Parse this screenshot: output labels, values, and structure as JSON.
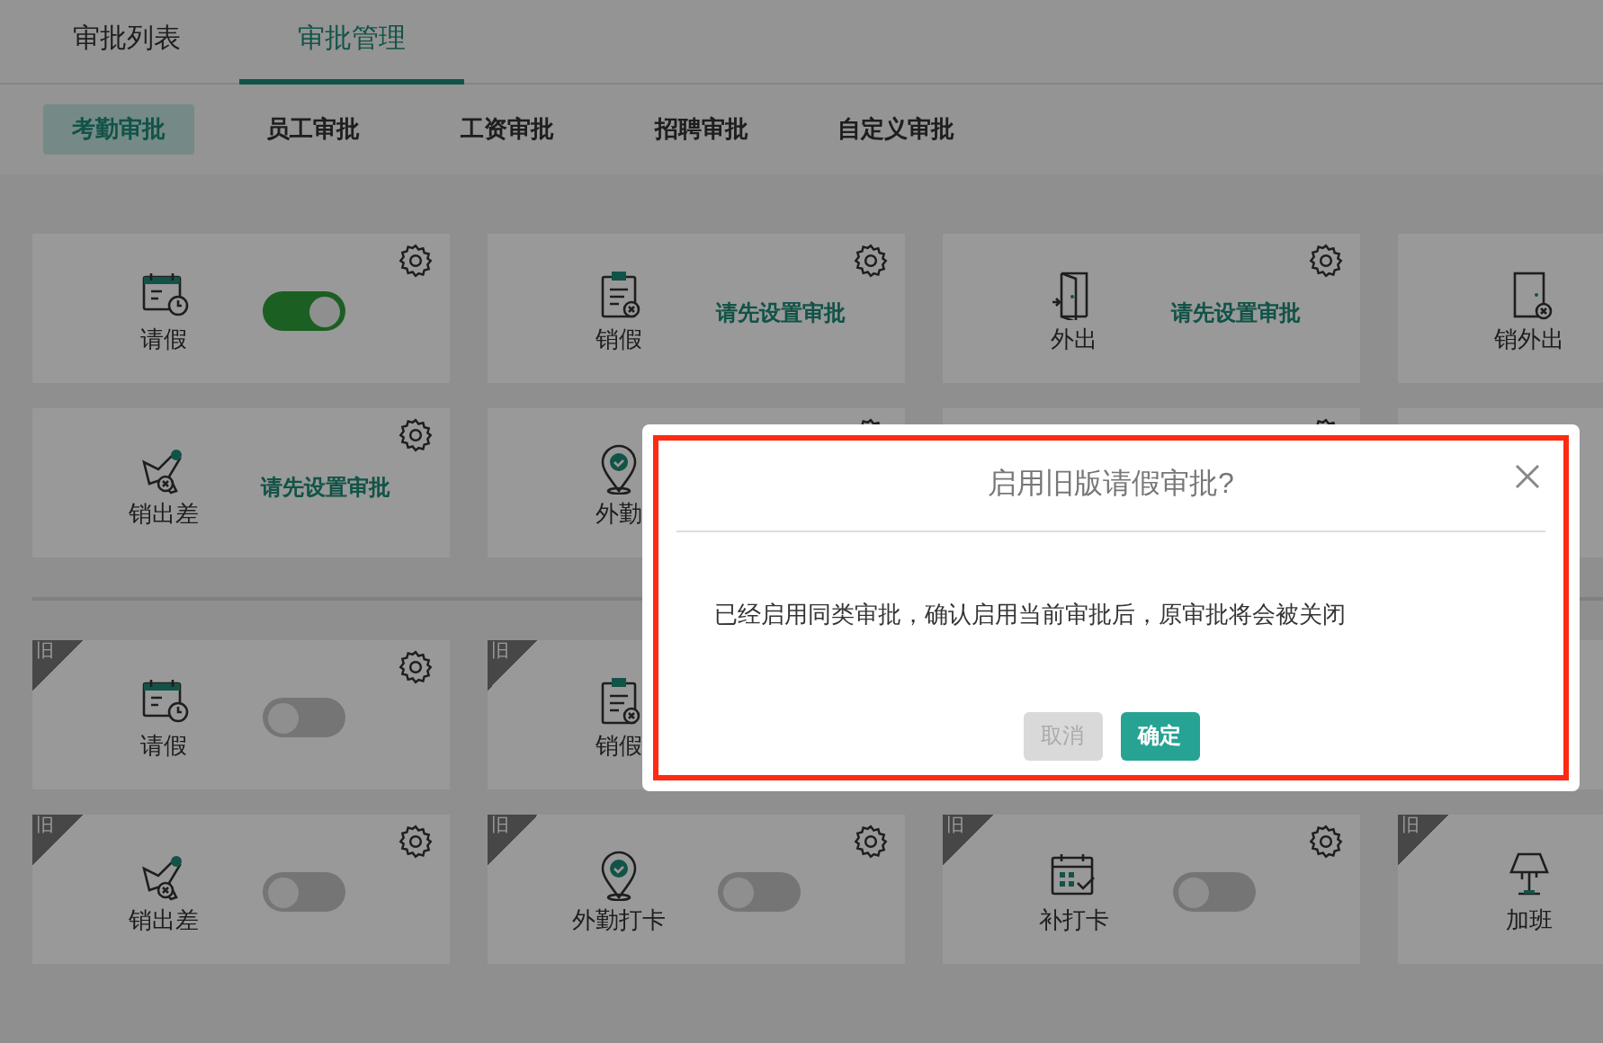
{
  "tabs": [
    {
      "label": "审批列表",
      "selected": false
    },
    {
      "label": "审批管理",
      "selected": true
    }
  ],
  "subtabs": [
    {
      "label": "考勤审批",
      "selected": true
    },
    {
      "label": "员工审批",
      "selected": false
    },
    {
      "label": "工资审批",
      "selected": false
    },
    {
      "label": "招聘审批",
      "selected": false
    },
    {
      "label": "自定义审批",
      "selected": false
    }
  ],
  "sections": [
    {
      "cards": [
        {
          "kind": "toggle",
          "label": "请假",
          "gear": true,
          "on": true
        },
        {
          "kind": "prompt",
          "label": "销假",
          "gear": true,
          "status": "请先设置审批"
        },
        {
          "kind": "prompt",
          "label": "外出",
          "gear": true,
          "status": "请先设置审批"
        },
        {
          "kind": "plain",
          "label": "销外出"
        },
        {
          "kind": "prompt",
          "label": "销出差",
          "gear": true,
          "status": "请先设置审批"
        },
        {
          "kind": "plain",
          "label": "外勤",
          "gear": true
        },
        {
          "kind": "plain",
          "gear": true
        },
        {
          "kind": "plain"
        }
      ]
    },
    {
      "cards": [
        {
          "kind": "toggle",
          "badge": "旧",
          "label": "请假",
          "gear": true,
          "on": false
        },
        {
          "kind": "plain",
          "badge": "旧",
          "label": "销假"
        },
        {
          "kind": "plain"
        },
        {
          "kind": "plain"
        },
        {
          "kind": "toggle",
          "badge": "旧",
          "label": "销出差",
          "gear": true,
          "on": false
        },
        {
          "kind": "toggle",
          "badge": "旧",
          "label": "外勤打卡",
          "gear": true,
          "on": false
        },
        {
          "kind": "toggle",
          "badge": "旧",
          "label": "补打卡",
          "gear": true,
          "on": false
        },
        {
          "kind": "plain",
          "badge": "旧",
          "label": "加班"
        }
      ]
    }
  ],
  "dialog": {
    "title": "启用旧版请假审批?",
    "message": "已经启用同类审批，确认启用当前审批后，原审批将会被关闭",
    "buttons": [
      {
        "label": "取消",
        "kind": "cancel",
        "disabled": true
      },
      {
        "label": "确定",
        "kind": "confirm",
        "disabled": false
      }
    ]
  }
}
